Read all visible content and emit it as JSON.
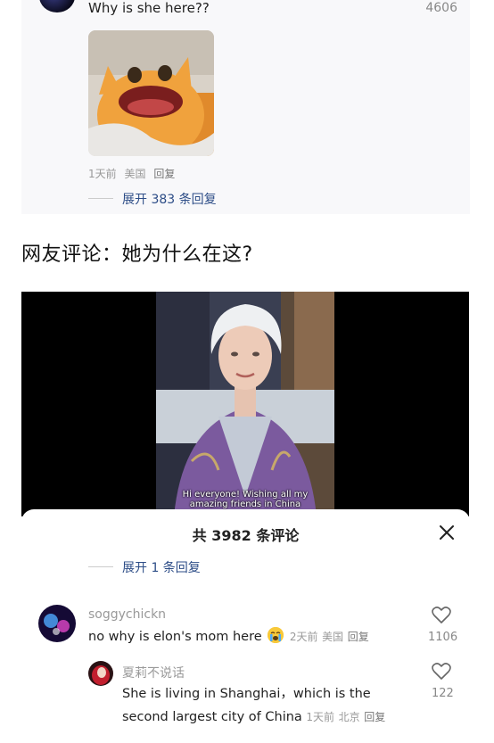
{
  "top_comment": {
    "text": "Why is she here??",
    "likes": "4606",
    "meta": {
      "time": "1天前",
      "location": "美国",
      "reply": "回复"
    },
    "expand": "展开 383 条回复"
  },
  "heading": "网友评论：她为什么在这?",
  "video": {
    "subtitle_line1": "Hi everyone! Wishing all my",
    "subtitle_line2": "amazing friends in China"
  },
  "sheet": {
    "title": "共 3982 条评论",
    "expand": "展开 1 条回复",
    "comments": [
      {
        "username": "soggychickn",
        "text": "no why is elon's mom here",
        "time": "2天前",
        "location": "美国",
        "reply": "回复",
        "likes": "1106"
      },
      {
        "username": "夏莉不说话",
        "text_line1": "She is living in Shanghai，which is the",
        "text_line2": "second largest city of China",
        "time": "1天前",
        "location": "北京",
        "reply": "回复",
        "likes": "122"
      }
    ]
  },
  "icons": {
    "close": "close-icon",
    "like": "heart-outline-icon",
    "emoji": "crying-face-emoji"
  },
  "colors": {
    "link": "#2d4d87",
    "meta": "#999999",
    "card_bg": "#f8f8fa"
  }
}
